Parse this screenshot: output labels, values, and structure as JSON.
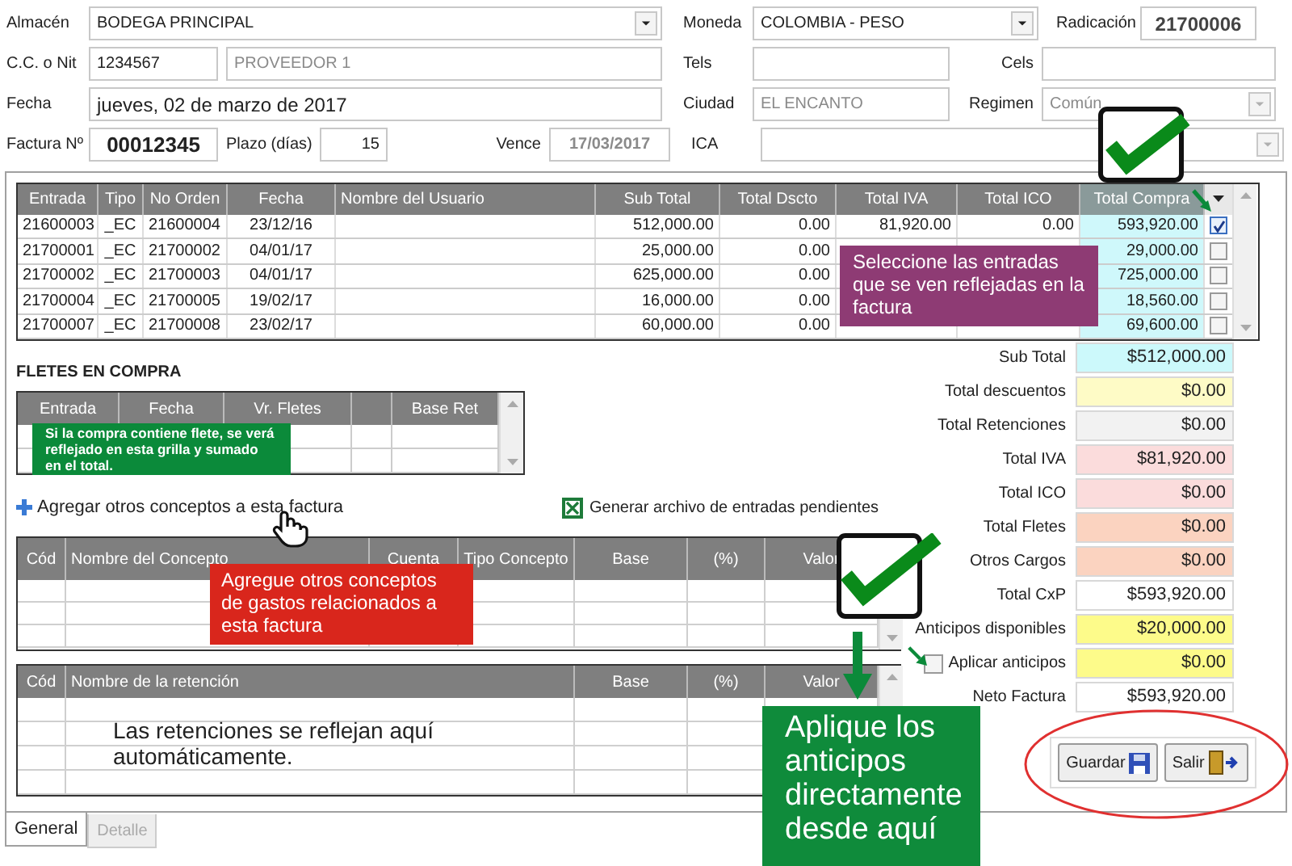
{
  "form": {
    "almacen": {
      "label": "Almacén",
      "value": "BODEGA PRINCIPAL"
    },
    "moneda": {
      "label": "Moneda",
      "value": "COLOMBIA - PESO"
    },
    "radicacion": {
      "label": "Radicación",
      "value": "21700006"
    },
    "nit": {
      "label": "C.C. o Nit",
      "value": "1234567"
    },
    "proveedor": {
      "value": "PROVEEDOR 1",
      "readonly": true
    },
    "tels": {
      "label": "Tels"
    },
    "cels": {
      "label": "Cels"
    },
    "fecha": {
      "label": "Fecha",
      "value": "jueves, 02 de marzo de 2017"
    },
    "ciudad": {
      "label": "Ciudad",
      "value": "EL ENCANTO",
      "readonly": true
    },
    "regimen": {
      "label": "Regimen",
      "value": "Común",
      "disabled": true
    },
    "factura": {
      "label": "Factura Nº",
      "value": "00012345"
    },
    "plazo": {
      "label": "Plazo (días)",
      "value": "15"
    },
    "vence": {
      "label": "Vence",
      "value": "17/03/2017",
      "readonly": true
    },
    "ica": {
      "label": "ICA",
      "disabled": true
    }
  },
  "entries": {
    "columns": [
      "Entrada",
      "Tipo",
      "No Orden",
      "Fecha",
      "Nombre del Usuario",
      "Sub Total",
      "Total Dscto",
      "Total IVA",
      "Total ICO",
      "Total Compra"
    ],
    "rows": [
      {
        "cells": [
          "21600003",
          "_EC",
          "21600004",
          "23/12/16",
          null,
          "512,000.00",
          "0.00",
          "81,920.00",
          "0.00",
          "593,920.00"
        ],
        "checked": true
      },
      {
        "cells": [
          "21700001",
          "_EC",
          "21700002",
          "04/01/17",
          null,
          "25,000.00",
          "0.00",
          null,
          null,
          "29,000.00"
        ],
        "checked": false
      },
      {
        "cells": [
          "21700002",
          "_EC",
          "21700003",
          "04/01/17",
          null,
          "625,000.00",
          "0.00",
          null,
          null,
          "725,000.00"
        ],
        "checked": false
      },
      {
        "cells": [
          "21700004",
          "_EC",
          "21700005",
          "19/02/17",
          null,
          "16,000.00",
          "0.00",
          null,
          null,
          "18,560.00"
        ],
        "checked": false
      },
      {
        "cells": [
          "21700007",
          "_EC",
          "21700008",
          "23/02/17",
          null,
          "60,000.00",
          "0.00",
          null,
          null,
          "69,600.00"
        ],
        "checked": false
      }
    ]
  },
  "fletes": {
    "title": "FLETES EN COMPRA",
    "columns": [
      {
        "kind": "text",
        "label": "Entrada"
      },
      {
        "kind": "text",
        "label": "Fecha"
      },
      {
        "kind": "text",
        "label": "Vr. Fletes"
      },
      {
        "kind": "blank"
      },
      {
        "kind": "text",
        "label": "Base Ret"
      }
    ]
  },
  "links": {
    "agregar": "Agregar otros conceptos a esta factura",
    "generar": "Generar archivo de entradas pendientes"
  },
  "concepts": {
    "columns": [
      "Cód",
      "Nombre del Concepto",
      "Cuenta",
      "Tipo Concepto",
      "Base",
      "(%)",
      "Valor"
    ]
  },
  "retentions": {
    "columns": [
      "Cód",
      "Nombre de la retención",
      "Base",
      "(%)",
      "Valor"
    ]
  },
  "totals": [
    {
      "kind": "plain",
      "label": "Sub Total",
      "value": "$512,000.00",
      "color": "#ccf9fb"
    },
    {
      "kind": "plain",
      "label": "Total descuentos",
      "value": "$0.00",
      "color": "#fefbc6"
    },
    {
      "kind": "plain",
      "label": "Total Retenciones",
      "value": "$0.00",
      "color": "#f2f2f2"
    },
    {
      "kind": "plain",
      "label": "Total IVA",
      "value": "$81,920.00",
      "color": "#fbdcdc"
    },
    {
      "kind": "plain",
      "label": "Total ICO",
      "value": "$0.00",
      "color": "#fbdcdc"
    },
    {
      "kind": "plain",
      "label": "Total Fletes",
      "value": "$0.00",
      "color": "#fbd3c0"
    },
    {
      "kind": "plain",
      "label": "Otros Cargos",
      "value": "$0.00",
      "color": "#fbd3c0"
    },
    {
      "kind": "plain",
      "label": "Total CxP",
      "value": "$593,920.00",
      "color": "#ffffff"
    },
    {
      "kind": "plain",
      "label": "Anticipos disponibles",
      "value": "$20,000.00",
      "color": "#fdfb8a"
    },
    {
      "kind": "checkbox",
      "label": "Aplicar anticipos",
      "value": "$0.00",
      "color": "#fdfb8a",
      "checked": false
    },
    {
      "kind": "plain",
      "label": "Neto Factura",
      "value": "$593,920.00",
      "color": "#ffffff"
    }
  ],
  "buttons": [
    {
      "kind": "save",
      "label": "Guardar"
    },
    {
      "kind": "exit",
      "label": "Salir"
    }
  ],
  "tabs": [
    {
      "label": "General",
      "selected": true,
      "disabled": false
    },
    {
      "label": "Detalle",
      "selected": false,
      "disabled": true
    }
  ],
  "notes": {
    "entries": {
      "text": "Seleccione las entradas que se ven reflejadas en la factura",
      "color": "#8e3b74"
    },
    "fletes": {
      "text": "Si la compra contiene flete, se verá reflejado en esta grilla y sumado en el total.",
      "color": "#0b8a3a"
    },
    "concepts": {
      "text": "Agregue otros conceptos de gastos relacionados a esta factura",
      "color": "#d9261c"
    },
    "retentions": {
      "text": "Las retenciones se reflejan aquí automáticamente."
    },
    "anticipos": {
      "text": "Aplique los anticipos directamente desde aquí",
      "color": "#0f8b3b"
    }
  }
}
